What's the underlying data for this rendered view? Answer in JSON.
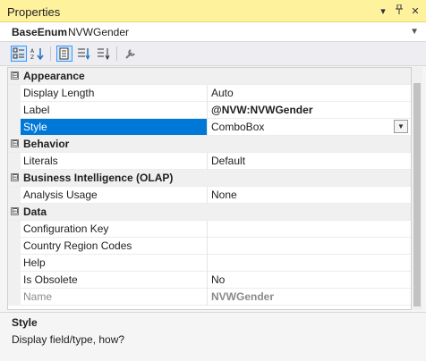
{
  "window": {
    "title": "Properties"
  },
  "object": {
    "type": "BaseEnum",
    "name": "NVWGender"
  },
  "toolbar": {
    "buttons": [
      "categorized-icon",
      "alphabetical-icon",
      "properties-icon",
      "events-icon",
      "sort-icon",
      "wrench-icon"
    ]
  },
  "categories": [
    {
      "name": "Appearance",
      "expander": "⊟",
      "props": [
        {
          "name": "Display Length",
          "value": "Auto"
        },
        {
          "name": "Label",
          "value": "@NVW:NVWGender"
        },
        {
          "name": "Style",
          "value": "ComboBox"
        }
      ]
    },
    {
      "name": "Behavior",
      "expander": "⊟",
      "props": [
        {
          "name": "Literals",
          "value": "Default"
        }
      ]
    },
    {
      "name": "Business Intelligence (OLAP)",
      "expander": "⊟",
      "props": [
        {
          "name": "Analysis Usage",
          "value": "None"
        }
      ]
    },
    {
      "name": "Data",
      "expander": "⊟",
      "props": [
        {
          "name": "Configuration Key",
          "value": ""
        },
        {
          "name": "Country Region Codes",
          "value": ""
        },
        {
          "name": "Help",
          "value": ""
        },
        {
          "name": "Is Obsolete",
          "value": "No"
        },
        {
          "name": "Name",
          "value": "NVWGender"
        }
      ]
    }
  ],
  "description": {
    "title": "Style",
    "text": "Display field/type, how?"
  },
  "colors": {
    "titlebar": "#fff29d",
    "selection": "#0078d7"
  }
}
